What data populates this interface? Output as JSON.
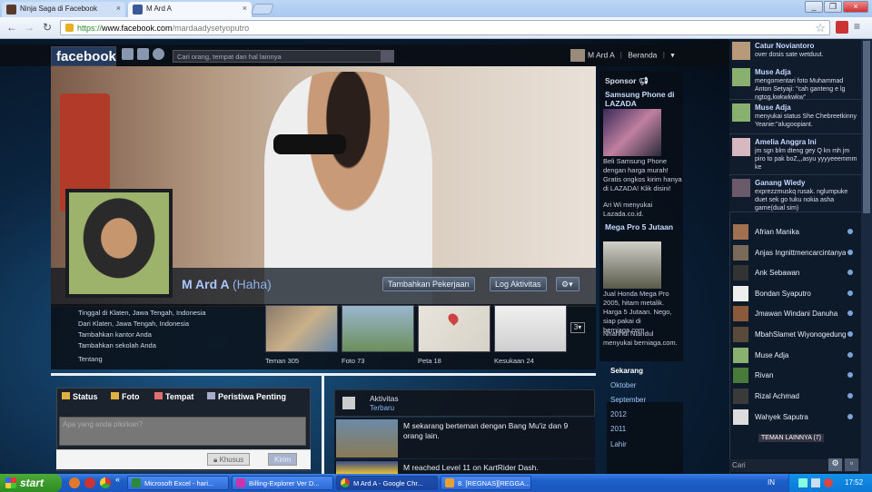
{
  "browser": {
    "tabs": [
      {
        "title": "Ninja Saga di Facebook",
        "active": false
      },
      {
        "title": "M Ard A",
        "active": true
      }
    ],
    "url_prefix": "https://",
    "url_host": "www.facebook.com",
    "url_path": "/mardaadysetyoputro"
  },
  "fb": {
    "logo": "facebook",
    "search_placeholder": "Cari orang, tempat dan hal lainnya",
    "user_name": "M Ard A",
    "home_label": "Beranda"
  },
  "profile": {
    "name": "M Ard A",
    "alt_name": "(Haha)",
    "add_work_button": "Tambahkan Pekerjaan",
    "activity_log_button": "Log Aktivitas",
    "info": [
      "Tinggal di Klaten, Jawa Tengah, Indonesia",
      "Dari Klaten, Jawa Tengah, Indonesia",
      "Tambahkan kantor Anda",
      "Tambahkan sekolah Anda"
    ],
    "about_label": "Tentang",
    "thumbs": [
      {
        "label": "Teman 305"
      },
      {
        "label": "Foto 73"
      },
      {
        "label": "Peta 18"
      },
      {
        "label": "Kesukaan 24"
      }
    ],
    "more_count": "3"
  },
  "composer": {
    "tabs": [
      "Status",
      "Foto",
      "Tempat",
      "Peristiwa Penting"
    ],
    "placeholder": "Apa yang anda pikirkan?",
    "privacy_button": "Khusus",
    "post_button": "Kirim"
  },
  "activity": {
    "title": "Aktivitas",
    "subtitle": "Terbaru",
    "items": [
      "M sekarang berteman dengan Bang Mu'iz dan 9 orang lain.",
      "M reached Level 11 on KartRider Dash."
    ]
  },
  "sponsor": {
    "header": "Sponsor",
    "ads": [
      {
        "title": "Samsung Phone di LAZADA",
        "body": "Beli Samsung Phone dengan harga murah! Gratis ongkos kirim hanya di LAZADA! Klik disini!",
        "social": "Ari Wi menyukai Lazada.co.id."
      },
      {
        "title": "Mega Pro 5 Jutaan",
        "body": "Jual Honda Mega Pro 2005, hitam metalik. Harga 5 Jutaan. Nego, siap pakai di berniaga.com",
        "social": "Nhahhul Nlandul menyukai berniaga.com."
      }
    ]
  },
  "timeline_nav": {
    "header": "Sekarang",
    "items": [
      "Oktober",
      "September",
      "2012",
      "2011",
      "Lahir"
    ]
  },
  "ticker": [
    {
      "name": "Catur Noviantoro",
      "text": "over dosis sate wetduut."
    },
    {
      "name": "Muse Adja",
      "text": "mengomentari foto Muhammad Anton Setyaji: \"cah ganteng e lg ngtog,kwkwkwkw\""
    },
    {
      "name": "Muse Adja",
      "text": "menyukai status She Chebreetkinny Yeanie:\"alugoopiant."
    },
    {
      "name": "Amelia Anggra Ini",
      "text": "jm sgn blm dteng gey Q kn mh jm piro to pak boZ,,,asyu yyyyeeemmm ke"
    },
    {
      "name": "Ganang Wiedy",
      "text": "exprezzmuskq rusak. nglumpuke duet sek go tuku nokia asha game(dual sim)"
    }
  ],
  "chat": {
    "friends": [
      "Afrian Manika",
      "Anjas Ingnittmencarcintanya",
      "Ank Sebawan",
      "Bondan Syaputro",
      "Jmawan Windani Danuha",
      "MbahSlamet Wiyonogedungejolik",
      "Muse Adja",
      "Rivan",
      "Rizal Achmad",
      "Wahyek Saputra"
    ],
    "more_label": "TEMAN LAINNYA (7)",
    "search_label": "Cari"
  },
  "taskbar": {
    "start": "start",
    "tasks": [
      "Microsoft Excel - hari...",
      "Billing-Explorer Ver D...",
      "M Ard A - Google Chr...",
      "8. [REGNAS][REGGA..."
    ],
    "lang": "IN",
    "clock": "17:52"
  }
}
